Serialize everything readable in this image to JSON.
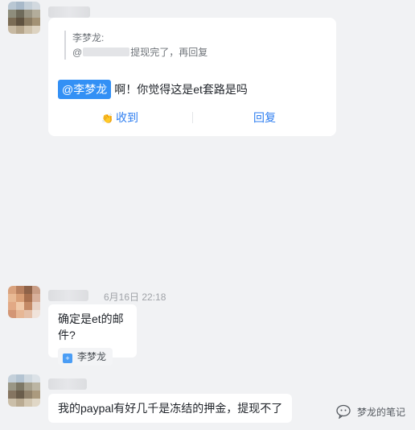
{
  "messages": [
    {
      "reply_card": {
        "quote_author": "李梦龙:",
        "quote_prefix": "@",
        "quote_text": "提现完了，再回复",
        "mention": "@李梦龙",
        "text": "啊！你觉得这是et套路是吗",
        "actions": {
          "received": "收到",
          "reply": "回复"
        }
      }
    },
    {
      "time": "6月16日 22:18",
      "text": "确定是et的邮件?",
      "mention_chip": "李梦龙"
    },
    {
      "text": "我的paypal有好几千是冻结的押金，提现不了"
    }
  ],
  "watermark": {
    "text": "梦龙的笔记"
  },
  "colors": {
    "accent": "#3390f5",
    "background": "#f1f2f4",
    "link": "#2e7ef0"
  }
}
